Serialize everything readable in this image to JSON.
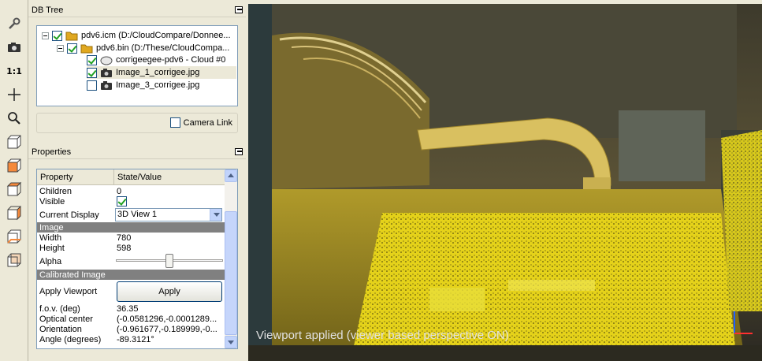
{
  "toolbar": {
    "buttons": [
      {
        "name": "wrench-icon"
      },
      {
        "name": "camera-icon"
      },
      {
        "name": "one-to-one-icon",
        "label": "1:1"
      },
      {
        "name": "crosshair-icon"
      },
      {
        "name": "zoom-icon"
      },
      {
        "name": "view-cube-front-icon"
      },
      {
        "name": "view-cube-top-icon"
      },
      {
        "name": "view-cube-left-icon"
      },
      {
        "name": "view-cube-right-icon"
      },
      {
        "name": "view-cube-bottom-icon"
      },
      {
        "name": "view-cube-back-icon"
      }
    ]
  },
  "db_tree": {
    "title": "DB Tree",
    "items": [
      {
        "label": "pdv6.icm (D:/CloudCompare/Donnee...",
        "icon": "folder-icon",
        "checked": true,
        "expander": true,
        "level": 0
      },
      {
        "label": "pdv6.bin (D:/These/CloudCompa...",
        "icon": "folder-icon",
        "checked": true,
        "expander": true,
        "level": 1
      },
      {
        "label": "corrigeegee-pdv6 - Cloud #0",
        "icon": "cloud-icon",
        "checked": true,
        "expander": false,
        "level": 2
      },
      {
        "label": "Image_1_corrigee.jpg",
        "icon": "camera-icon",
        "checked": true,
        "expander": false,
        "level": 2,
        "selected": true
      },
      {
        "label": "Image_3_corrigee.jpg",
        "icon": "camera-icon",
        "checked": false,
        "expander": false,
        "level": 2
      }
    ],
    "camera_link_label": "Camera Link",
    "camera_link_checked": false
  },
  "properties": {
    "title": "Properties",
    "headers": {
      "property": "Property",
      "value": "State/Value"
    },
    "rows": {
      "children": {
        "k": "Children",
        "v": "0"
      },
      "visible": {
        "k": "Visible",
        "checked": true
      },
      "current_display": {
        "k": "Current Display",
        "v": "3D View 1"
      },
      "image_section": "Image",
      "width": {
        "k": "Width",
        "v": "780"
      },
      "height": {
        "k": "Height",
        "v": "598"
      },
      "alpha": {
        "k": "Alpha",
        "level": 0.5
      },
      "calibrated_section": "Calibrated Image",
      "apply_viewport": {
        "k": "Apply Viewport",
        "button": "Apply"
      },
      "fov": {
        "k": "f.o.v. (deg)",
        "v": "36.35"
      },
      "optical_center": {
        "k": "Optical center",
        "v": "(-0.0581296,-0.0001289..."
      },
      "orientation": {
        "k": "Orientation",
        "v": "(-0.961677,-0.189999,-0..."
      },
      "angle": {
        "k": "Angle (degrees)",
        "v": "-89.3121°"
      }
    }
  },
  "viewport": {
    "message": "Viewport applied (viewer based perspective ON)"
  }
}
